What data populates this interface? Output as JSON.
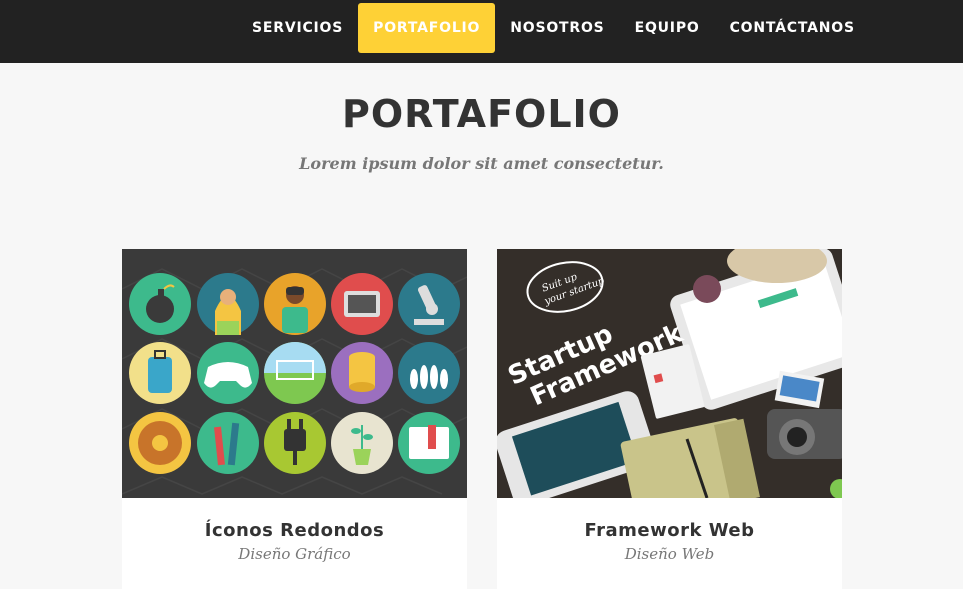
{
  "nav": {
    "items": [
      {
        "label": "SERVICIOS",
        "active": false
      },
      {
        "label": "PORTAFOLIO",
        "active": true
      },
      {
        "label": "NOSOTROS",
        "active": false
      },
      {
        "label": "EQUIPO",
        "active": false
      },
      {
        "label": "CONTÁCTANOS",
        "active": false
      }
    ]
  },
  "portfolio": {
    "heading": "PORTAFOLIO",
    "subheading": "Lorem ipsum dolor sit amet consectetur.",
    "items": [
      {
        "title": "Íconos Redondos",
        "category": "Diseño Gráfico",
        "image": "round-icons-grid-image"
      },
      {
        "title": "Framework Web",
        "category": "Diseño Web",
        "image": "startup-framework-devices-image",
        "image_text": {
          "badge_line1": "Suit up",
          "badge_line2": "your startup",
          "headline_line1": "Startup",
          "headline_line2": "Framework"
        }
      }
    ]
  },
  "colors": {
    "nav_bg": "#222222",
    "accent": "#fed136",
    "page_bg": "#f7f7f7",
    "heading": "#333333",
    "muted": "#777777"
  }
}
